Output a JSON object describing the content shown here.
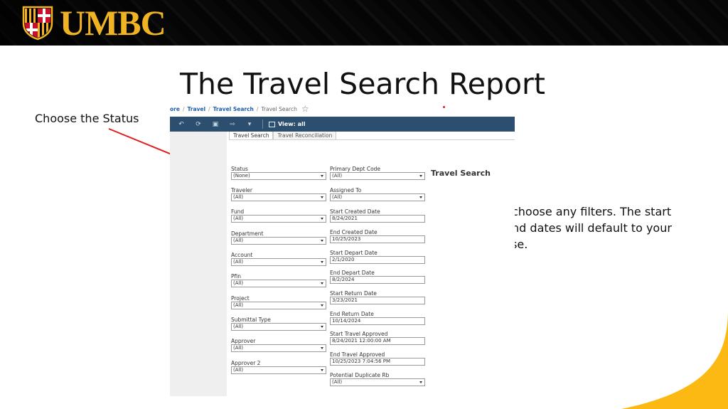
{
  "header": {
    "logo_text": "UMBC",
    "logo_colors": {
      "gold": "#f0b323",
      "red": "#c8102e",
      "black": "#000000"
    }
  },
  "slide": {
    "title": "The Travel Search Report",
    "note_status": "Choose the Status",
    "note_filters": "Then choose any filters.  The start and end dates will default to your last use.",
    "accent_color": "#fdb913"
  },
  "app": {
    "breadcrumb": {
      "items": [
        "ore",
        "Travel",
        "Travel Search"
      ],
      "current": "Travel Search"
    },
    "toolbar": {
      "view_label": "View: all",
      "bg_color": "#2d4f6f"
    },
    "tabs": [
      "Travel Search",
      "Travel Reconciliation"
    ],
    "panel_title": "Travel Search",
    "filters_left": [
      {
        "label": "Status",
        "value": "(None)"
      },
      {
        "label": "Traveler",
        "value": "(All)"
      },
      {
        "label": "Fund",
        "value": "(All)"
      },
      {
        "label": "Department",
        "value": "(All)"
      },
      {
        "label": "Account",
        "value": "(All)"
      },
      {
        "label": "Pfin",
        "value": "(All)"
      },
      {
        "label": "Project",
        "value": "(All)"
      },
      {
        "label": "Submittal Type",
        "value": "(All)"
      },
      {
        "label": "Approver",
        "value": "(All)"
      },
      {
        "label": "Approver 2",
        "value": "(All)"
      }
    ],
    "filters_right": [
      {
        "label": "Primary Dept Code",
        "value": "(All)"
      },
      {
        "label": "Assigned To",
        "value": "(All)"
      },
      {
        "label": "Start Created Date",
        "value": "8/24/2021"
      },
      {
        "label": "End Created Date",
        "value": "10/25/2023"
      },
      {
        "label": "Start Depart Date",
        "value": "2/1/2020"
      },
      {
        "label": "End Depart Date",
        "value": "8/2/2024"
      },
      {
        "label": "Start Return Date",
        "value": "3/23/2021"
      },
      {
        "label": "End Return Date",
        "value": "10/14/2024"
      },
      {
        "label": "Start Travel Approved",
        "value": "8/24/2021 12:00:00 AM"
      },
      {
        "label": "End Travel Approved",
        "value": "10/25/2023 7:04:56 PM"
      },
      {
        "label": "Potential Duplicate Rb",
        "value": "(All)"
      }
    ]
  }
}
